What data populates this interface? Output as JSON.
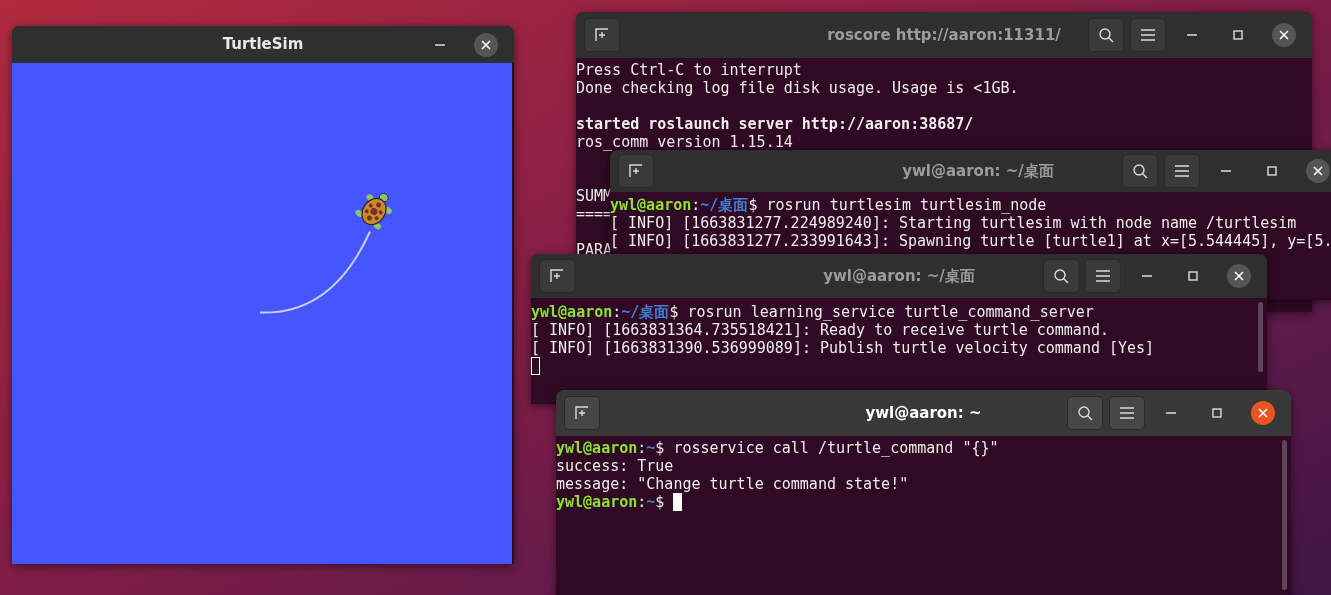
{
  "windows": [
    {
      "kind": "turtlesim",
      "title": "TurtleSim",
      "active": false
    },
    {
      "kind": "terminal",
      "title": "roscore http://aaron:11311/",
      "active": false,
      "scrollbar": false,
      "lines": [
        {
          "kind": "text",
          "segments": [
            {
              "kind": "plain",
              "text": "Press Ctrl-C to interrupt"
            }
          ]
        },
        {
          "kind": "text",
          "segments": [
            {
              "kind": "plain",
              "text": "Done checking log file disk usage. Usage is <1GB."
            }
          ]
        },
        {
          "kind": "blank"
        },
        {
          "kind": "text",
          "segments": [
            {
              "kind": "bold",
              "text": "started roslaunch server http://aaron:38687/"
            }
          ]
        },
        {
          "kind": "text",
          "segments": [
            {
              "kind": "plain",
              "text": "ros_comm version 1.15.14"
            }
          ]
        },
        {
          "kind": "blank"
        },
        {
          "kind": "blank"
        },
        {
          "kind": "text",
          "segments": [
            {
              "kind": "plain",
              "text": "SUMM"
            }
          ]
        },
        {
          "kind": "text",
          "segments": [
            {
              "kind": "plain",
              "text": "===="
            }
          ]
        },
        {
          "kind": "blank"
        },
        {
          "kind": "text",
          "segments": [
            {
              "kind": "plain",
              "text": "PARA"
            }
          ]
        }
      ]
    },
    {
      "kind": "terminal",
      "title": "ywl@aaron: ~/桌面",
      "active": false,
      "scrollbar": false,
      "lines": [
        {
          "kind": "text",
          "segments": [
            {
              "kind": "user",
              "text": "ywl@aaron"
            },
            {
              "kind": "plain",
              "text": ":"
            },
            {
              "kind": "path",
              "text": "~/桌面"
            },
            {
              "kind": "plain",
              "text": "$ rosrun turtlesim turtlesim_node"
            }
          ]
        },
        {
          "kind": "text",
          "segments": [
            {
              "kind": "plain",
              "text": "[ INFO] [1663831277.224989240]: Starting turtlesim with node name /turtlesim"
            }
          ]
        },
        {
          "kind": "text",
          "segments": [
            {
              "kind": "plain",
              "text": "[ INFO] [1663831277.233991643]: Spawning turtle [turtle1] at x=[5.544445], y=[5."
            }
          ]
        }
      ]
    },
    {
      "kind": "terminal",
      "title": "ywl@aaron: ~/桌面",
      "active": false,
      "scrollbar": true,
      "lines": [
        {
          "kind": "text",
          "segments": [
            {
              "kind": "user",
              "text": "ywl@aaron"
            },
            {
              "kind": "plain",
              "text": ":"
            },
            {
              "kind": "path",
              "text": "~/桌面"
            },
            {
              "kind": "plain",
              "text": "$ rosrun learning_service turtle_command_server"
            }
          ]
        },
        {
          "kind": "text",
          "segments": [
            {
              "kind": "plain",
              "text": "[ INFO] [1663831364.735518421]: Ready to receive turtle command."
            }
          ]
        },
        {
          "kind": "text",
          "segments": [
            {
              "kind": "plain",
              "text": "[ INFO] [1663831390.536999089]: Publish turtle velocity command [Yes]"
            }
          ]
        },
        {
          "kind": "text",
          "cursor": true
        }
      ]
    },
    {
      "kind": "terminal",
      "title": "ywl@aaron: ~",
      "active": true,
      "scrollbar": true,
      "lines": [
        {
          "kind": "text",
          "segments": [
            {
              "kind": "user",
              "text": "ywl@aaron"
            },
            {
              "kind": "plain",
              "text": ":"
            },
            {
              "kind": "path",
              "text": "~"
            },
            {
              "kind": "plain",
              "text": "$ rosservice call /turtle_command \"{}\""
            }
          ]
        },
        {
          "kind": "text",
          "segments": [
            {
              "kind": "plain",
              "text": "success: True"
            }
          ]
        },
        {
          "kind": "text",
          "segments": [
            {
              "kind": "plain",
              "text": "message: \"Change turtle command state!\""
            }
          ]
        },
        {
          "kind": "text",
          "segments": [
            {
              "kind": "user",
              "text": "ywl@aaron"
            },
            {
              "kind": "plain",
              "text": ":"
            },
            {
              "kind": "path",
              "text": "~"
            },
            {
              "kind": "plain",
              "text": "$ "
            }
          ],
          "cursor": true
        }
      ]
    }
  ]
}
